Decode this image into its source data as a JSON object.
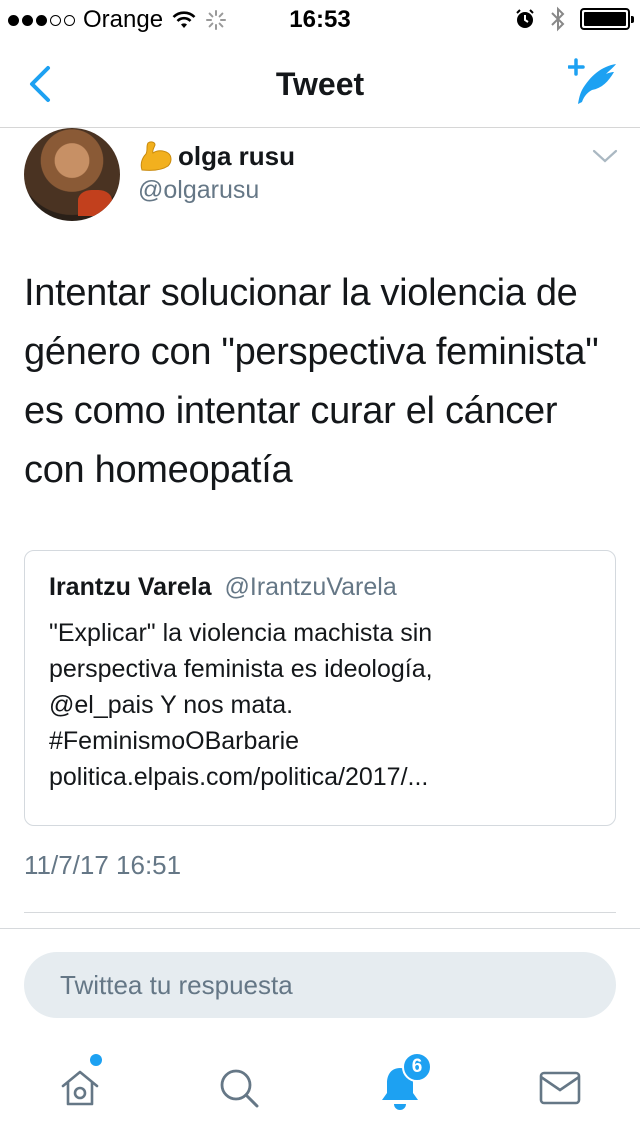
{
  "status_bar": {
    "carrier": "Orange",
    "time": "16:53"
  },
  "nav": {
    "title": "Tweet"
  },
  "tweet": {
    "author_name": "olga rusu",
    "author_emoji": "flexed-biceps-icon",
    "author_handle": "@olgarusu",
    "text": "Intentar solucionar la violencia de género con \"perspectiva feminista\" es como intentar curar el cáncer con homeopatía",
    "timestamp": "11/7/17 16:51"
  },
  "quoted_tweet": {
    "author_name": "Irantzu Varela",
    "author_handle": "@IrantzuVarela",
    "lines": [
      "\"Explicar\" la violencia machista sin",
      "perspectiva feminista es ideología,",
      "@el_pais Y nos mata.",
      "#FeminismoOBarbarie",
      "politica.elpais.com/politica/2017/..."
    ]
  },
  "reply": {
    "placeholder": "Twittea tu respuesta"
  },
  "tab_bar": {
    "notifications_badge": "6"
  },
  "colors": {
    "accent": "#1da1f2",
    "secondary_text": "#657786",
    "reply_bg": "#e6ecf0"
  }
}
